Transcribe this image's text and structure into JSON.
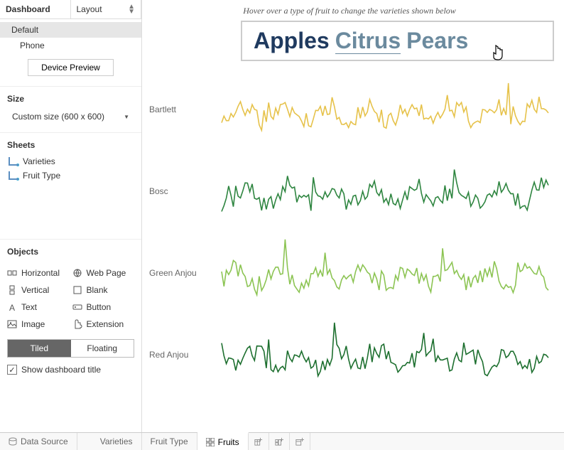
{
  "left": {
    "tabs": {
      "dashboard": "Dashboard",
      "layout": "Layout"
    },
    "devices": [
      "Default",
      "Phone"
    ],
    "device_preview": "Device Preview",
    "size_header": "Size",
    "size_value": "Custom size (600 x 600)",
    "sheets_header": "Sheets",
    "sheets": [
      "Varieties",
      "Fruit Type"
    ],
    "objects_header": "Objects",
    "objects": [
      {
        "label": "Horizontal",
        "icon": "horizontal"
      },
      {
        "label": "Web Page",
        "icon": "webpage"
      },
      {
        "label": "Vertical",
        "icon": "vertical"
      },
      {
        "label": "Blank",
        "icon": "blank"
      },
      {
        "label": "Text",
        "icon": "text"
      },
      {
        "label": "Button",
        "icon": "button"
      },
      {
        "label": "Image",
        "icon": "image"
      },
      {
        "label": "Extension",
        "icon": "extension"
      }
    ],
    "tiled": "Tiled",
    "floating": "Floating",
    "show_title": "Show dashboard title"
  },
  "canvas": {
    "hint": "Hover over a type of fruit to change the varieties shown below",
    "title_words": [
      "Apples",
      "Citrus",
      "Pears"
    ]
  },
  "chart_data": [
    {
      "label": "Bartlett",
      "color": "#e6c24a",
      "seed": 11
    },
    {
      "label": "Bosc",
      "color": "#2e8540",
      "seed": 23
    },
    {
      "label": "Green Anjou",
      "color": "#8cc453",
      "seed": 37
    },
    {
      "label": "Red Anjou",
      "color": "#1d6f2f",
      "seed": 53
    }
  ],
  "bottom": {
    "data_source": "Data Source",
    "tabs": [
      "Varieties",
      "Fruit Type",
      "Fruits"
    ]
  }
}
